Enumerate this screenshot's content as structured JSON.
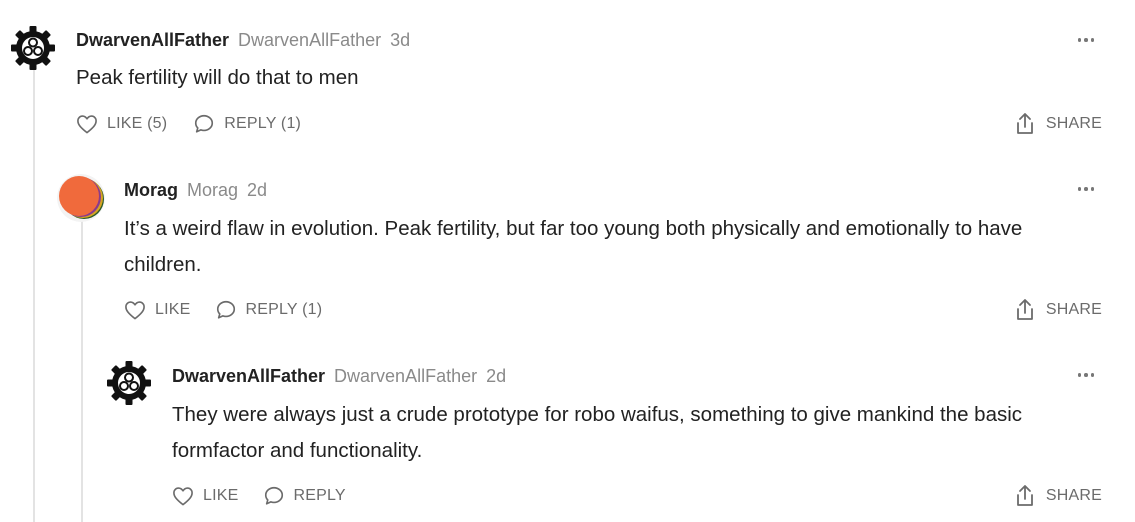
{
  "comments": [
    {
      "author": "DwarvenAllFather",
      "handle": "DwarvenAllFather",
      "time": "3d",
      "avatar_icon": "gear-icon",
      "text": "Peak fertility will do that to men",
      "like_label": "LIKE (5)",
      "reply_label": "REPLY (1)",
      "share_label": "SHARE"
    },
    {
      "author": "Morag",
      "handle": "Morag",
      "time": "2d",
      "avatar_icon": "gradient-avatar",
      "text": "It’s a weird flaw in evolution. Peak fertility, but far too young both physically and emotionally to have children.",
      "like_label": "LIKE",
      "reply_label": "REPLY (1)",
      "share_label": "SHARE"
    },
    {
      "author": "DwarvenAllFather",
      "handle": "DwarvenAllFather",
      "time": "2d",
      "avatar_icon": "gear-icon",
      "text": "They were always just a crude prototype for robo waifus, something to give mankind the basic formfactor and functionality.",
      "like_label": "LIKE",
      "reply_label": "REPLY",
      "share_label": "SHARE"
    }
  ],
  "colors": {
    "text": "#222222",
    "muted": "#8a8a8a",
    "action": "#6b6b6b",
    "thread_line": "#e3e3e3"
  }
}
